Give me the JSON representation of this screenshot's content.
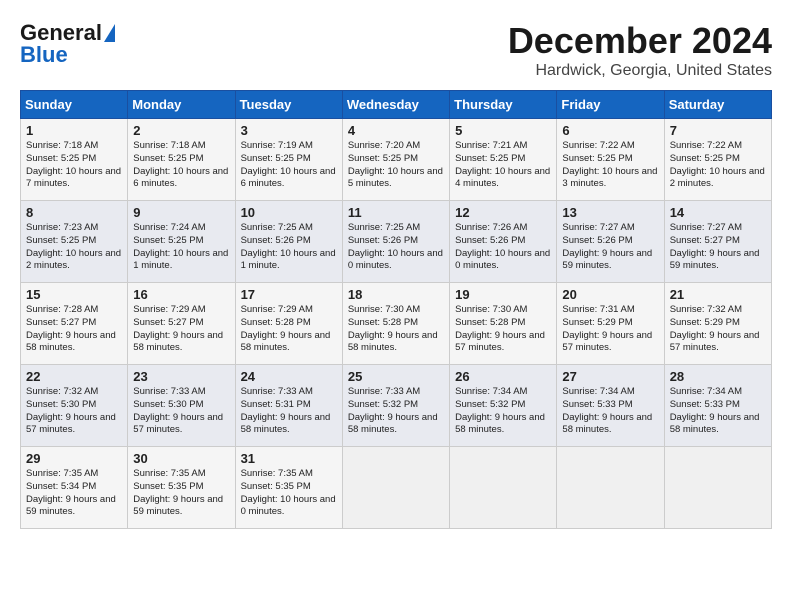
{
  "logo": {
    "line1": "General",
    "line2": "Blue",
    "arrow": "▶"
  },
  "title": "December 2024",
  "location": "Hardwick, Georgia, United States",
  "days_of_week": [
    "Sunday",
    "Monday",
    "Tuesday",
    "Wednesday",
    "Thursday",
    "Friday",
    "Saturday"
  ],
  "weeks": [
    [
      {
        "day": 1,
        "sunrise": "Sunrise: 7:18 AM",
        "sunset": "Sunset: 5:25 PM",
        "daylight": "Daylight: 10 hours and 7 minutes."
      },
      {
        "day": 2,
        "sunrise": "Sunrise: 7:18 AM",
        "sunset": "Sunset: 5:25 PM",
        "daylight": "Daylight: 10 hours and 6 minutes."
      },
      {
        "day": 3,
        "sunrise": "Sunrise: 7:19 AM",
        "sunset": "Sunset: 5:25 PM",
        "daylight": "Daylight: 10 hours and 6 minutes."
      },
      {
        "day": 4,
        "sunrise": "Sunrise: 7:20 AM",
        "sunset": "Sunset: 5:25 PM",
        "daylight": "Daylight: 10 hours and 5 minutes."
      },
      {
        "day": 5,
        "sunrise": "Sunrise: 7:21 AM",
        "sunset": "Sunset: 5:25 PM",
        "daylight": "Daylight: 10 hours and 4 minutes."
      },
      {
        "day": 6,
        "sunrise": "Sunrise: 7:22 AM",
        "sunset": "Sunset: 5:25 PM",
        "daylight": "Daylight: 10 hours and 3 minutes."
      },
      {
        "day": 7,
        "sunrise": "Sunrise: 7:22 AM",
        "sunset": "Sunset: 5:25 PM",
        "daylight": "Daylight: 10 hours and 2 minutes."
      }
    ],
    [
      {
        "day": 8,
        "sunrise": "Sunrise: 7:23 AM",
        "sunset": "Sunset: 5:25 PM",
        "daylight": "Daylight: 10 hours and 2 minutes."
      },
      {
        "day": 9,
        "sunrise": "Sunrise: 7:24 AM",
        "sunset": "Sunset: 5:25 PM",
        "daylight": "Daylight: 10 hours and 1 minute."
      },
      {
        "day": 10,
        "sunrise": "Sunrise: 7:25 AM",
        "sunset": "Sunset: 5:26 PM",
        "daylight": "Daylight: 10 hours and 1 minute."
      },
      {
        "day": 11,
        "sunrise": "Sunrise: 7:25 AM",
        "sunset": "Sunset: 5:26 PM",
        "daylight": "Daylight: 10 hours and 0 minutes."
      },
      {
        "day": 12,
        "sunrise": "Sunrise: 7:26 AM",
        "sunset": "Sunset: 5:26 PM",
        "daylight": "Daylight: 10 hours and 0 minutes."
      },
      {
        "day": 13,
        "sunrise": "Sunrise: 7:27 AM",
        "sunset": "Sunset: 5:26 PM",
        "daylight": "Daylight: 9 hours and 59 minutes."
      },
      {
        "day": 14,
        "sunrise": "Sunrise: 7:27 AM",
        "sunset": "Sunset: 5:27 PM",
        "daylight": "Daylight: 9 hours and 59 minutes."
      }
    ],
    [
      {
        "day": 15,
        "sunrise": "Sunrise: 7:28 AM",
        "sunset": "Sunset: 5:27 PM",
        "daylight": "Daylight: 9 hours and 58 minutes."
      },
      {
        "day": 16,
        "sunrise": "Sunrise: 7:29 AM",
        "sunset": "Sunset: 5:27 PM",
        "daylight": "Daylight: 9 hours and 58 minutes."
      },
      {
        "day": 17,
        "sunrise": "Sunrise: 7:29 AM",
        "sunset": "Sunset: 5:28 PM",
        "daylight": "Daylight: 9 hours and 58 minutes."
      },
      {
        "day": 18,
        "sunrise": "Sunrise: 7:30 AM",
        "sunset": "Sunset: 5:28 PM",
        "daylight": "Daylight: 9 hours and 58 minutes."
      },
      {
        "day": 19,
        "sunrise": "Sunrise: 7:30 AM",
        "sunset": "Sunset: 5:28 PM",
        "daylight": "Daylight: 9 hours and 57 minutes."
      },
      {
        "day": 20,
        "sunrise": "Sunrise: 7:31 AM",
        "sunset": "Sunset: 5:29 PM",
        "daylight": "Daylight: 9 hours and 57 minutes."
      },
      {
        "day": 21,
        "sunrise": "Sunrise: 7:32 AM",
        "sunset": "Sunset: 5:29 PM",
        "daylight": "Daylight: 9 hours and 57 minutes."
      }
    ],
    [
      {
        "day": 22,
        "sunrise": "Sunrise: 7:32 AM",
        "sunset": "Sunset: 5:30 PM",
        "daylight": "Daylight: 9 hours and 57 minutes."
      },
      {
        "day": 23,
        "sunrise": "Sunrise: 7:33 AM",
        "sunset": "Sunset: 5:30 PM",
        "daylight": "Daylight: 9 hours and 57 minutes."
      },
      {
        "day": 24,
        "sunrise": "Sunrise: 7:33 AM",
        "sunset": "Sunset: 5:31 PM",
        "daylight": "Daylight: 9 hours and 58 minutes."
      },
      {
        "day": 25,
        "sunrise": "Sunrise: 7:33 AM",
        "sunset": "Sunset: 5:32 PM",
        "daylight": "Daylight: 9 hours and 58 minutes."
      },
      {
        "day": 26,
        "sunrise": "Sunrise: 7:34 AM",
        "sunset": "Sunset: 5:32 PM",
        "daylight": "Daylight: 9 hours and 58 minutes."
      },
      {
        "day": 27,
        "sunrise": "Sunrise: 7:34 AM",
        "sunset": "Sunset: 5:33 PM",
        "daylight": "Daylight: 9 hours and 58 minutes."
      },
      {
        "day": 28,
        "sunrise": "Sunrise: 7:34 AM",
        "sunset": "Sunset: 5:33 PM",
        "daylight": "Daylight: 9 hours and 58 minutes."
      }
    ],
    [
      {
        "day": 29,
        "sunrise": "Sunrise: 7:35 AM",
        "sunset": "Sunset: 5:34 PM",
        "daylight": "Daylight: 9 hours and 59 minutes."
      },
      {
        "day": 30,
        "sunrise": "Sunrise: 7:35 AM",
        "sunset": "Sunset: 5:35 PM",
        "daylight": "Daylight: 9 hours and 59 minutes."
      },
      {
        "day": 31,
        "sunrise": "Sunrise: 7:35 AM",
        "sunset": "Sunset: 5:35 PM",
        "daylight": "Daylight: 10 hours and 0 minutes."
      },
      null,
      null,
      null,
      null
    ]
  ]
}
